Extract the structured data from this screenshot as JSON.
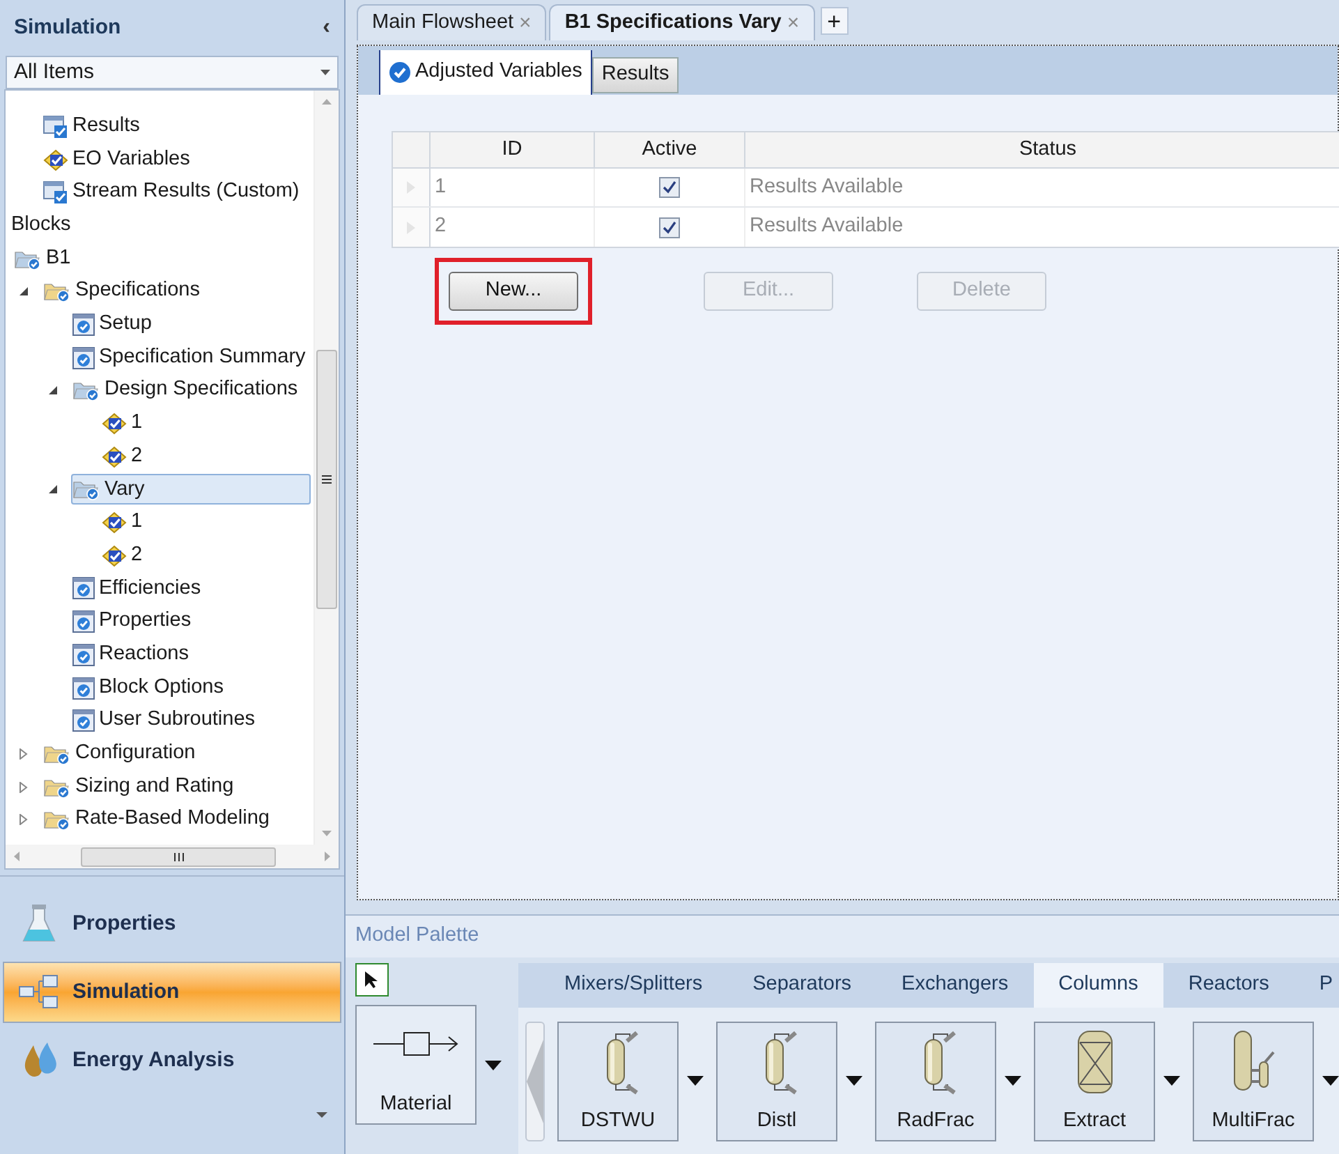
{
  "navigator": {
    "title": "Simulation",
    "collapse_glyph": "‹",
    "filter": {
      "value": "All Items"
    },
    "tree": {
      "stream_items": [
        {
          "label": "Results",
          "kind": "results",
          "selected": false
        },
        {
          "label": "EO Variables",
          "kind": "eo",
          "selected": false
        },
        {
          "label": "Stream Results (Custom)",
          "kind": "results",
          "selected": false
        }
      ],
      "blocks_heading": "Blocks",
      "blocks": [
        {
          "label": "B1",
          "kind": "folder-blue",
          "selected": false,
          "children": [
            {
              "label": "Specifications",
              "kind": "folder-yellow",
              "selected": false,
              "expanded": true,
              "children": [
                {
                  "label": "Setup",
                  "kind": "form",
                  "selected": false
                },
                {
                  "label": "Specification Summary",
                  "kind": "form",
                  "selected": false
                },
                {
                  "label": "Design Specifications",
                  "kind": "folder-blue",
                  "selected": false,
                  "expanded": true,
                  "children": [
                    {
                      "label": "1",
                      "kind": "eo",
                      "selected": false
                    },
                    {
                      "label": "2",
                      "kind": "eo",
                      "selected": false
                    }
                  ]
                },
                {
                  "label": "Vary",
                  "kind": "folder-blue",
                  "selected": true,
                  "expanded": true,
                  "children": [
                    {
                      "label": "1",
                      "kind": "eo",
                      "selected": false
                    },
                    {
                      "label": "2",
                      "kind": "eo",
                      "selected": false
                    }
                  ]
                },
                {
                  "label": "Efficiencies",
                  "kind": "form",
                  "selected": false
                },
                {
                  "label": "Properties",
                  "kind": "form",
                  "selected": false
                },
                {
                  "label": "Reactions",
                  "kind": "form",
                  "selected": false
                },
                {
                  "label": "Block Options",
                  "kind": "form",
                  "selected": false
                },
                {
                  "label": "User Subroutines",
                  "kind": "form",
                  "selected": false
                }
              ]
            },
            {
              "label": "Configuration",
              "kind": "folder-yellow",
              "selected": false,
              "expanded": false
            },
            {
              "label": "Sizing and Rating",
              "kind": "folder-yellow",
              "selected": false,
              "expanded": false
            },
            {
              "label": "Rate-Based Modeling",
              "kind": "folder-yellow",
              "selected": false,
              "expanded": false
            }
          ]
        }
      ]
    },
    "modules": [
      {
        "label": "Properties",
        "kind": "flask",
        "selected": false
      },
      {
        "label": "Simulation",
        "kind": "hierarchy",
        "selected": true
      },
      {
        "label": "Energy Analysis",
        "kind": "drops",
        "selected": false
      }
    ]
  },
  "document_tabs": [
    {
      "label": "Main Flowsheet",
      "selected": false,
      "close_glyph": "×"
    },
    {
      "label": "B1 Specifications Vary",
      "selected": true,
      "close_glyph": "×"
    }
  ],
  "new_tab_glyph": "+",
  "form_tabs": [
    {
      "label": "Adjusted Variables",
      "selected": true,
      "complete": true
    },
    {
      "label": "Results",
      "selected": false,
      "complete": false
    }
  ],
  "table": {
    "columns": [
      "ID",
      "Active",
      "Status"
    ],
    "rows": [
      {
        "id": "1",
        "active": true,
        "status": "Results Available"
      },
      {
        "id": "2",
        "active": true,
        "status": "Results Available"
      }
    ]
  },
  "buttons": [
    {
      "label": "New...",
      "disabled": false,
      "highlighted": true
    },
    {
      "label": "Edit...",
      "disabled": true,
      "highlighted": false
    },
    {
      "label": "Delete",
      "disabled": true,
      "highlighted": false
    }
  ],
  "model_palette": {
    "title": "Model Palette",
    "stream": {
      "label": "Material"
    },
    "tabs": [
      {
        "label": "Mixers/Splitters",
        "selected": false
      },
      {
        "label": "Separators",
        "selected": false
      },
      {
        "label": "Exchangers",
        "selected": false
      },
      {
        "label": "Columns",
        "selected": true
      },
      {
        "label": "Reactors",
        "selected": false
      },
      {
        "label": "P",
        "selected": false
      }
    ],
    "models": [
      {
        "label": "DSTWU",
        "kind": "column"
      },
      {
        "label": "Distl",
        "kind": "column"
      },
      {
        "label": "RadFrac",
        "kind": "column"
      },
      {
        "label": "Extract",
        "kind": "extractor"
      },
      {
        "label": "MultiFrac",
        "kind": "multicolumn"
      }
    ]
  }
}
